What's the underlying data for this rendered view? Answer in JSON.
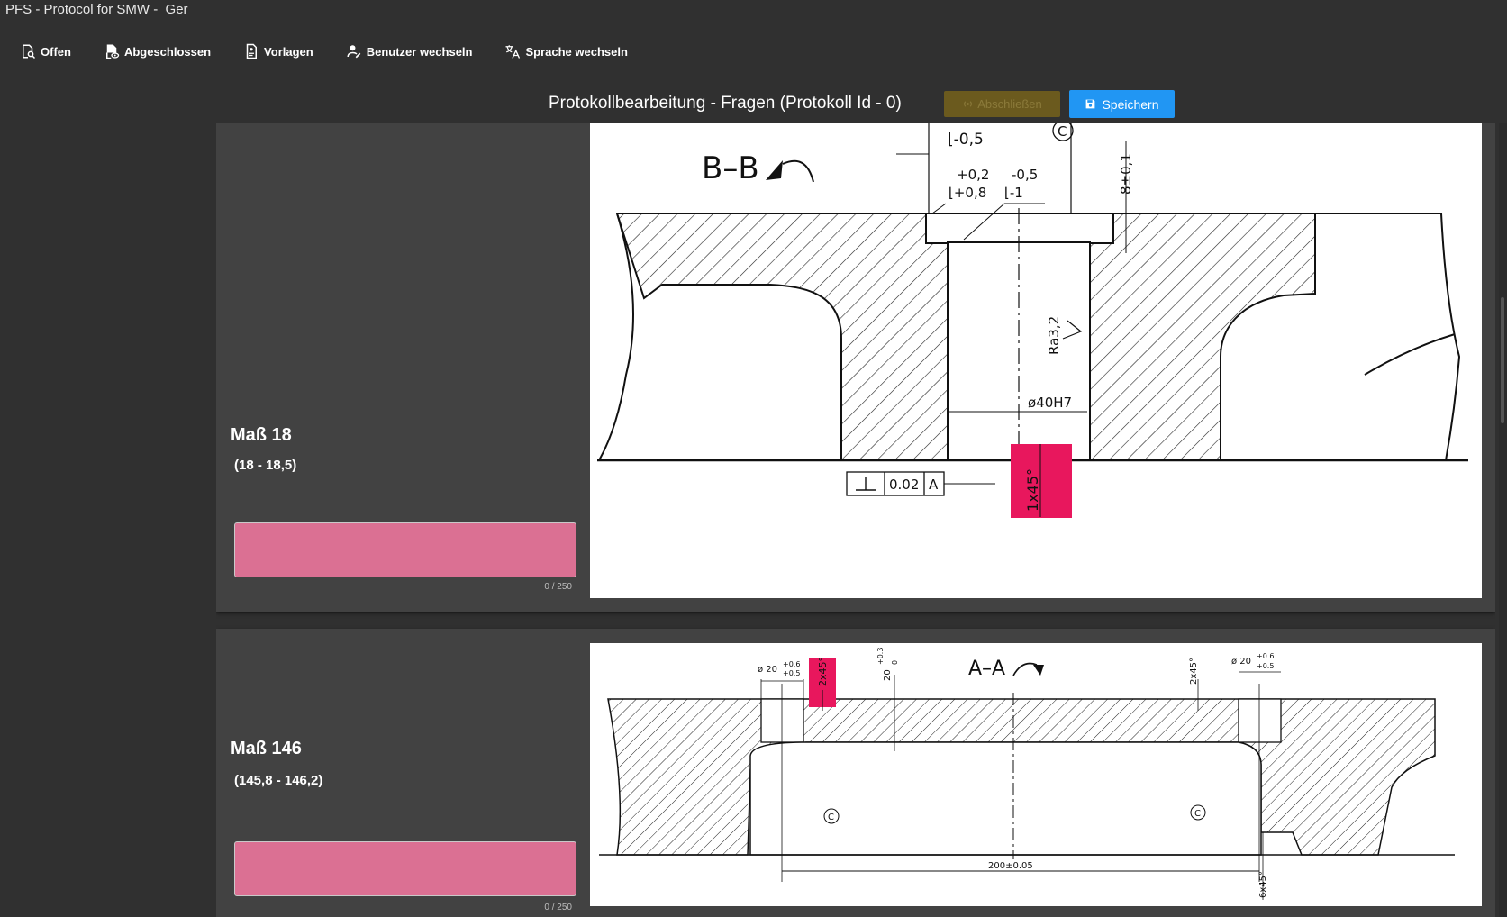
{
  "window": {
    "title": "PFS - Protocol for SMW -  Ger"
  },
  "toolbar": {
    "items": [
      {
        "label": "Offen",
        "icon": "search-doc-icon"
      },
      {
        "label": "Abgeschlossen",
        "icon": "doc-eye-icon"
      },
      {
        "label": "Vorlagen",
        "icon": "template-icon"
      },
      {
        "label": "Benutzer wechseln",
        "icon": "user-switch-icon"
      },
      {
        "label": "Sprache wechseln",
        "icon": "translate-icon"
      }
    ]
  },
  "header": {
    "title": "Protokollbearbeitung - Fragen (Protokoll Id - 0)",
    "finish_label": "Abschließen",
    "save_label": "Speichern"
  },
  "questions": [
    {
      "title": "Maß 18",
      "range": "(18 - 18,5)",
      "value": "",
      "counter": "0 / 250",
      "drawing": {
        "section": "B–B",
        "labels": [
          "⌊-0,5",
          "+0,2",
          "⌊+0,8",
          "-0,5",
          "⌊-1",
          "8±0,1",
          "Ra3,2",
          "ø40H7",
          "0.02",
          "A",
          "1x45°",
          "C"
        ],
        "highlight": "1x45°"
      }
    },
    {
      "title": "Maß 146",
      "range": "(145,8 - 146,2)",
      "value": "",
      "counter": "0 / 250",
      "drawing": {
        "section": "A–A",
        "labels": [
          "ø 20",
          "+0.6",
          "+0.5",
          "2x45°",
          "20",
          "+0.3",
          "0",
          "2x45°",
          "ø 20",
          "+0.6",
          "+0.5",
          "C",
          "C",
          "200±0.05",
          "6x45°"
        ],
        "highlight": "2x45°"
      }
    }
  ],
  "colors": {
    "background": "#303030",
    "card": "#424242",
    "input": "#db7093",
    "primary": "#2196f3",
    "highlight": "#e8175d"
  }
}
